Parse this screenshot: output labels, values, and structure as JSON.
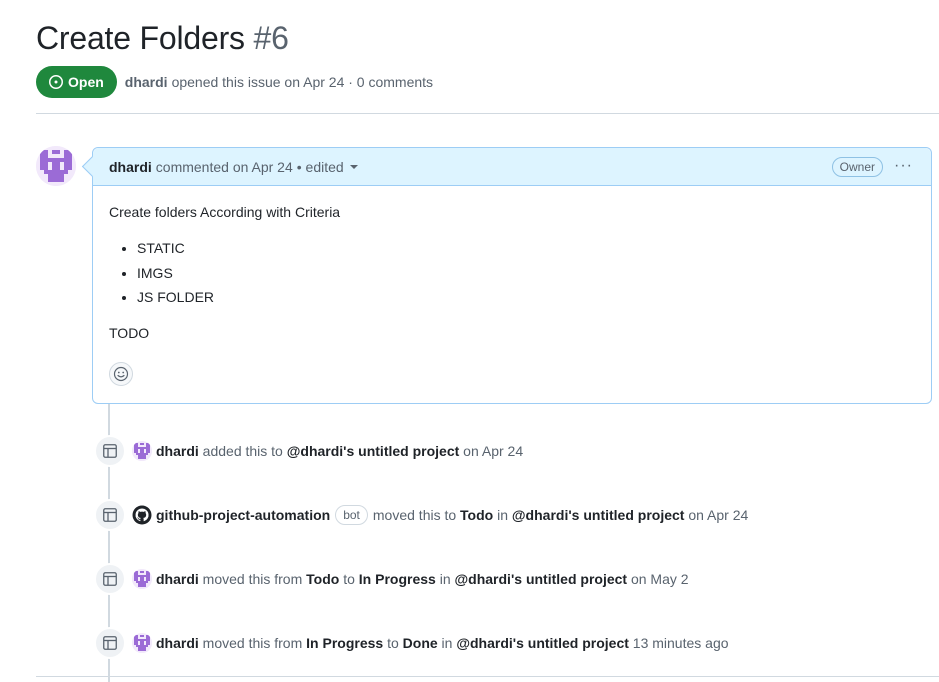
{
  "issue": {
    "title": "Create Folders",
    "number": "#6",
    "state": "Open",
    "author": "dhardi",
    "meta_text": "opened this issue on Apr 24 · 0 comments"
  },
  "comment": {
    "author": "dhardi",
    "action": "commented on Apr 24",
    "edited": "• edited",
    "role_badge": "Owner",
    "menu": "···",
    "body_intro": "Create folders According with Criteria",
    "list": [
      "STATIC",
      "IMGS",
      "JS FOLDER"
    ],
    "body_outro": "TODO"
  },
  "events": [
    {
      "actor": "dhardi",
      "parts": [
        {
          "t": " added this to ",
          "b": false
        },
        {
          "t": "@dhardi's untitled project",
          "b": true
        },
        {
          "t": " on Apr 24",
          "b": false
        }
      ]
    },
    {
      "actor": "github-project-automation",
      "badge": "bot",
      "parts": [
        {
          "t": "moved this to ",
          "b": false
        },
        {
          "t": "Todo",
          "b": true
        },
        {
          "t": " in ",
          "b": false
        },
        {
          "t": "@dhardi's untitled project",
          "b": true
        },
        {
          "t": " on Apr 24",
          "b": false
        }
      ]
    },
    {
      "actor": "dhardi",
      "parts": [
        {
          "t": " moved this from ",
          "b": false
        },
        {
          "t": "Todo",
          "b": true
        },
        {
          "t": " to ",
          "b": false
        },
        {
          "t": "In Progress",
          "b": true
        },
        {
          "t": " in ",
          "b": false
        },
        {
          "t": "@dhardi's untitled project",
          "b": true
        },
        {
          "t": " on May 2",
          "b": false
        }
      ]
    },
    {
      "actor": "dhardi",
      "parts": [
        {
          "t": " moved this from ",
          "b": false
        },
        {
          "t": "In Progress",
          "b": true
        },
        {
          "t": " to ",
          "b": false
        },
        {
          "t": "Done",
          "b": true
        },
        {
          "t": " in ",
          "b": false
        },
        {
          "t": "@dhardi's untitled project",
          "b": true
        },
        {
          "t": " 13 minutes ago",
          "b": false
        }
      ]
    }
  ],
  "colors": {
    "open_green": "#1f883d",
    "comment_header_bg": "#ddf4ff",
    "comment_border": "#9dcdf5",
    "avatar_purple": "#9b6bd6"
  }
}
